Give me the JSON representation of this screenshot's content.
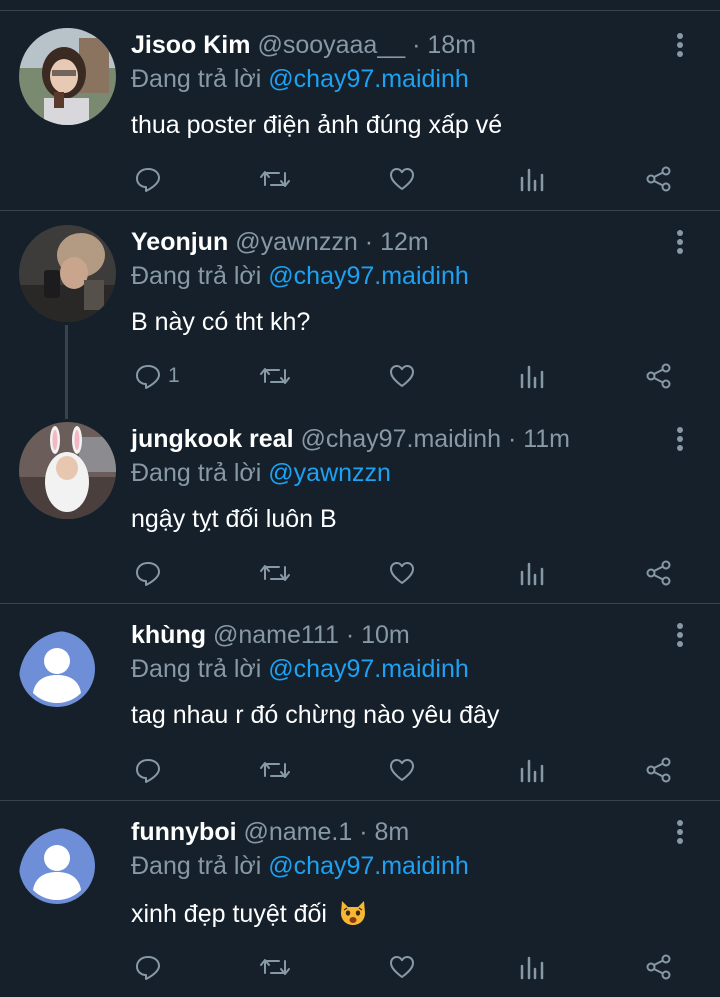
{
  "colors": {
    "background": "#15202b",
    "divider": "#38444d",
    "muted": "#8899a6",
    "accent": "#1da1f2"
  },
  "icons": [
    "more-vertical-icon",
    "reply-icon",
    "retweet-icon",
    "like-icon",
    "analytics-icon",
    "share-icon"
  ],
  "tweets": [
    {
      "name": "Jisoo Kim",
      "handle": "@sooyaaa__",
      "time": "18m",
      "reply_prefix": "Đang trả lời",
      "reply_to": "@chay97.maidinh",
      "text": "thua poster điện ảnh đúng xấp vé",
      "reply_count": ""
    },
    {
      "name": "Yeonjun",
      "handle": "@yawnzzn",
      "time": "12m",
      "reply_prefix": "Đang trả lời",
      "reply_to": "@chay97.maidinh",
      "text": "B này có tht kh?",
      "reply_count": "1"
    },
    {
      "name": "jungkook real",
      "handle": "@chay97.maidinh",
      "time": "11m",
      "reply_prefix": "Đang trả lời",
      "reply_to": "@yawnzzn",
      "text": "ngậy tỵt đối luôn B",
      "reply_count": ""
    },
    {
      "name": "khùng",
      "handle": "@name111",
      "time": "10m",
      "reply_prefix": "Đang trả lời",
      "reply_to": "@chay97.maidinh",
      "text": "tag nhau r đó chừng nào yêu đây",
      "reply_count": ""
    },
    {
      "name": "funnyboi",
      "handle": "@name.1",
      "time": "8m",
      "reply_prefix": "Đang trả lời",
      "reply_to": "@chay97.maidinh",
      "text": "xinh đẹp tuyệt đối",
      "reply_count": ""
    }
  ],
  "separator": "·"
}
